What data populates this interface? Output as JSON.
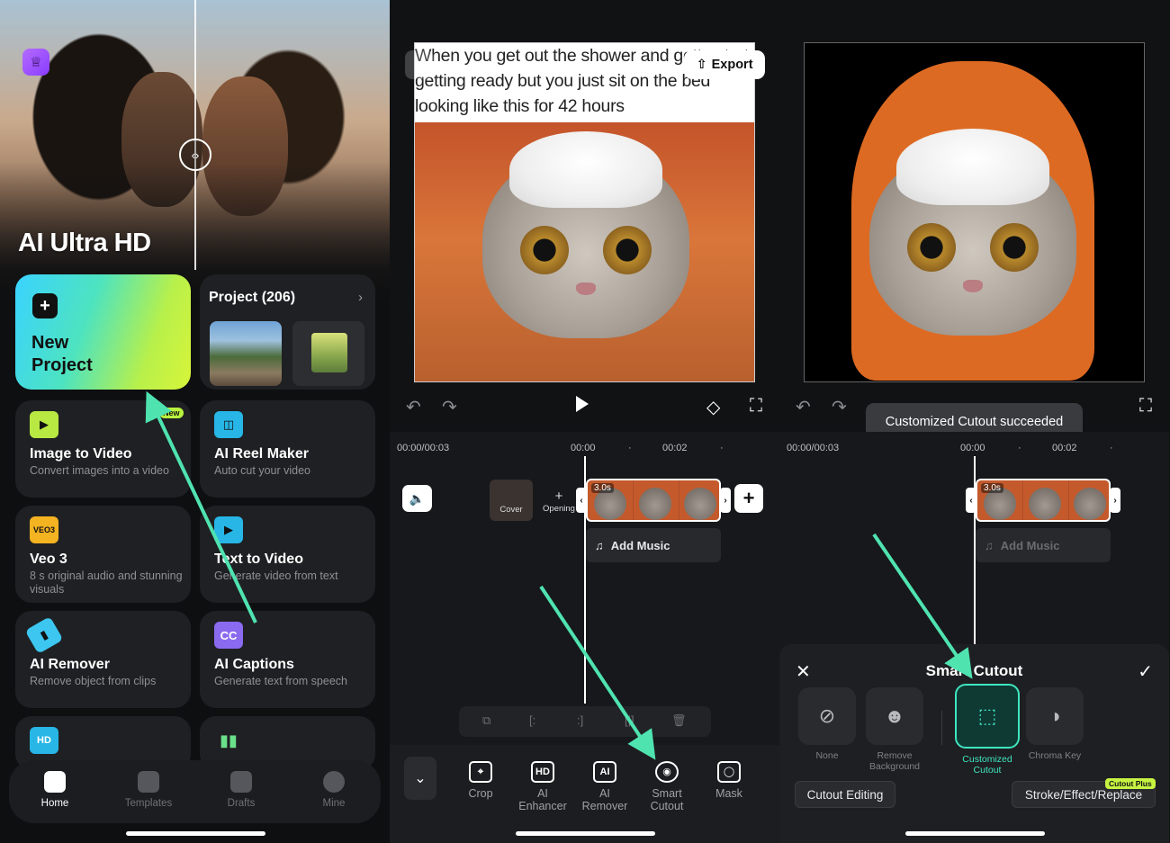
{
  "panel1": {
    "hero_title": "AI Ultra HD",
    "new_project_label": "New\nProject",
    "project_title": "Project (206)",
    "features": [
      {
        "name": "Image to Video",
        "desc": "Convert images into a video",
        "badge": "New",
        "icon": "image-to-video-icon"
      },
      {
        "name": "AI Reel Maker",
        "desc": "Auto cut your video",
        "icon": "reel-maker-icon"
      },
      {
        "name": "Veo 3",
        "desc": "8 s original audio and stunning visuals",
        "icon": "veo3-icon",
        "icon_text": "VEO3"
      },
      {
        "name": "Text to Video",
        "desc": "Generate video from text",
        "icon": "text-to-video-icon"
      },
      {
        "name": "AI Remover",
        "desc": "Remove object from clips",
        "icon": "eraser-icon"
      },
      {
        "name": "AI Captions",
        "desc": "Generate text from speech",
        "icon": "captions-icon",
        "icon_text": "CC"
      }
    ],
    "partial_icons": {
      "hd": "HD"
    },
    "nav": [
      {
        "label": "Home",
        "icon": "home-icon",
        "active": true
      },
      {
        "label": "Templates",
        "icon": "templates-icon",
        "active": false
      },
      {
        "label": "Drafts",
        "icon": "drafts-icon",
        "active": false
      },
      {
        "label": "Mine",
        "icon": "profile-icon",
        "active": false
      }
    ]
  },
  "panel2": {
    "meme_caption": "When you get out the shower and gotta start getting ready but you just sit on the bed looking like this for 42 hours",
    "export_label": "Export",
    "time_current": "00:00/00:03",
    "tick_0": "00:00",
    "tick_2": "00:02",
    "cover_label": "Cover",
    "opening_label": "Opening",
    "clip_duration": "3.0s",
    "add_music": "Add Music",
    "tools": [
      {
        "label": "Crop",
        "icon": "crop-icon"
      },
      {
        "label": "AI Enhancer",
        "icon": "ai-enhancer-icon"
      },
      {
        "label": "AI Remover",
        "icon": "ai-remover-icon"
      },
      {
        "label": "Smart Cutout",
        "icon": "smart-cutout-icon"
      },
      {
        "label": "Mask",
        "icon": "mask-icon"
      }
    ]
  },
  "panel3": {
    "toast": "Customized Cutout succeeded",
    "time_current": "00:00/00:03",
    "tick_0": "00:00",
    "tick_2": "00:02",
    "clip_duration": "3.0s",
    "add_music": "Add Music",
    "sheet_title": "Smart Cutout",
    "options": [
      {
        "label": "None",
        "icon": "none-icon"
      },
      {
        "label": "Remove Background",
        "icon": "remove-background-icon"
      },
      {
        "label": "Customized Cutout",
        "icon": "customized-cutout-icon",
        "selected": true
      },
      {
        "label": "Chroma Key",
        "icon": "chroma-key-icon"
      }
    ],
    "cutout_editing": "Cutout Editing",
    "stroke_label": "Stroke/Effect/Replace",
    "cutout_plus_badge": "Cutout Plus"
  },
  "colors": {
    "accent_teal": "#3ee6c0",
    "arrow": "#4fe3b0",
    "lime_badge": "#c6f342"
  }
}
